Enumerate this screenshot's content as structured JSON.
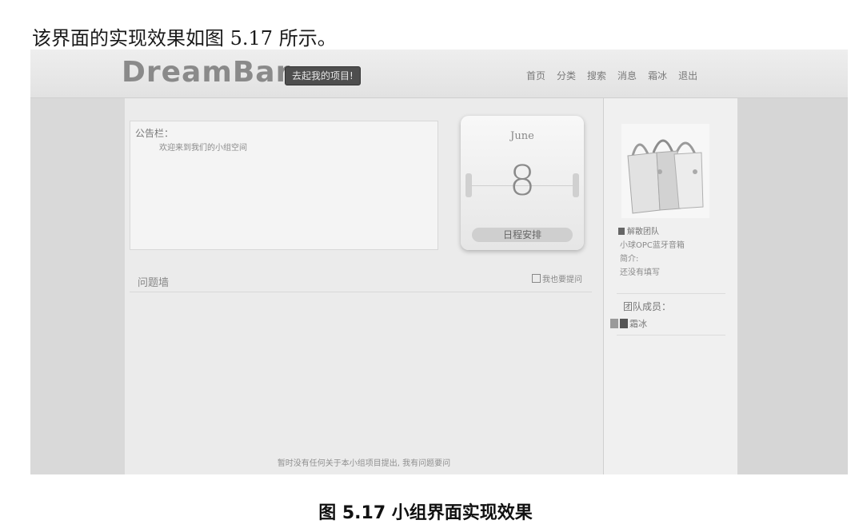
{
  "intro_text": "该界面的实现效果如图 5.17 所示。",
  "app": {
    "logo": "DreamBar",
    "start_button": "去起我的项目!",
    "nav": [
      "首页",
      "分类",
      "搜索",
      "消息",
      "霜冰",
      "退出"
    ]
  },
  "notice": {
    "title": "公告栏：",
    "text": "欢迎来到我们的小组空间"
  },
  "calendar": {
    "month": "June",
    "day": "8",
    "button": "日程安排"
  },
  "question_wall": {
    "title": "问题墙",
    "ask_link": "我也要提问",
    "empty_message": "暂时没有任何关于本小组项目提出, 我有问题要问"
  },
  "sidebar": {
    "image_alt": "bags-image",
    "team_name": "解散团队",
    "project_line": "小球OPC蓝牙音箱",
    "intro_label": "简介:",
    "intro_value": "还没有填写",
    "members_title": "团队成员：",
    "members": [
      "霜冰"
    ]
  },
  "caption": "图 5.17 小组界面实现效果"
}
